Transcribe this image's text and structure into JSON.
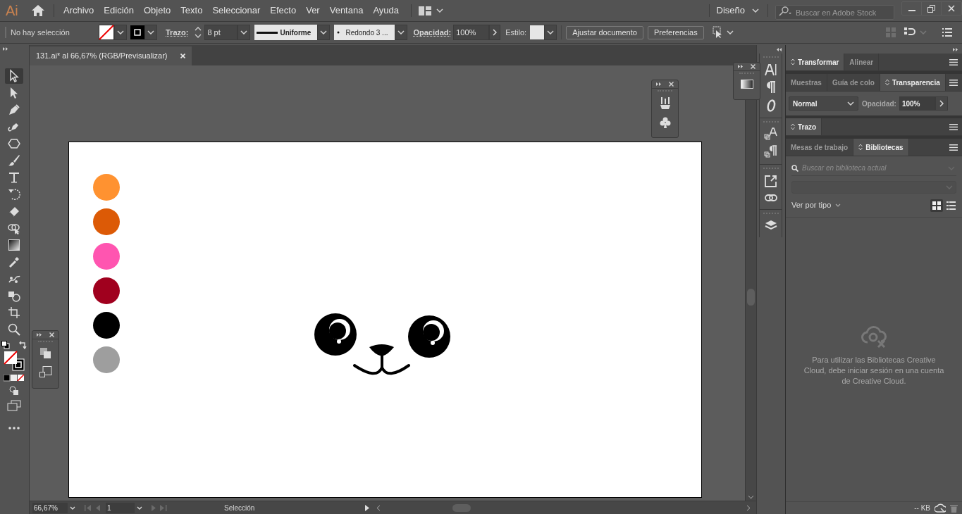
{
  "app_logo": "Ai",
  "menu": [
    "Archivo",
    "Edición",
    "Objeto",
    "Texto",
    "Seleccionar",
    "Efecto",
    "Ver",
    "Ventana",
    "Ayuda"
  ],
  "workspace": "Diseño",
  "stock_search": {
    "placeholder": "Buscar en Adobe Stock"
  },
  "control_bar": {
    "selection": "No hay selección",
    "stroke_label": "Trazo:",
    "stroke_weight": "8 pt",
    "stroke_profile": "Uniforme",
    "brush": "Redondo 3 ...",
    "opacity_label": "Opacidad:",
    "opacity": "100%",
    "style_label": "Estilo:",
    "buttons": [
      "Ajustar documento",
      "Preferencias"
    ]
  },
  "document_tab": {
    "title": "131.ai* al 66,67% (RGB/Previsualizar)"
  },
  "tools": [
    {
      "kind": "selection",
      "selected": true
    },
    {
      "kind": "direct-selection",
      "selected": false
    },
    {
      "kind": "pen",
      "selected": false
    },
    {
      "kind": "curvature",
      "selected": false
    },
    {
      "kind": "polygon",
      "selected": false
    },
    {
      "kind": "brush",
      "selected": false
    },
    {
      "kind": "type",
      "selected": false
    },
    {
      "kind": "rotate",
      "selected": false
    },
    {
      "kind": "eraser",
      "selected": false
    },
    {
      "kind": "shape-builder",
      "selected": false
    },
    {
      "kind": "gradient",
      "selected": false
    },
    {
      "kind": "eyedropper",
      "selected": false
    },
    {
      "kind": "puppet-warp",
      "selected": false
    },
    {
      "kind": "blend",
      "selected": false
    },
    {
      "kind": "artboard",
      "selected": false
    },
    {
      "kind": "zoom",
      "selected": false
    }
  ],
  "swatches": [
    {
      "color": "#ff9230"
    },
    {
      "color": "#dc5a06"
    },
    {
      "color": "#ff55b0"
    },
    {
      "color": "#a0001e"
    },
    {
      "color": "#000000"
    },
    {
      "color": "#9e9e9e"
    }
  ],
  "panels": [
    {
      "tabs": [
        {
          "label": "Transformar",
          "selected": true
        },
        {
          "label": "Alinear",
          "selected": false
        }
      ]
    },
    {
      "tabs": [
        {
          "label": "Muestras",
          "selected": false
        },
        {
          "label": "Guía de colo",
          "selected": false
        },
        {
          "label": "Transparencia",
          "selected": true
        }
      ]
    },
    {
      "tabs": [
        {
          "label": "Trazo",
          "selected": true
        }
      ]
    },
    {
      "tabs": [
        {
          "label": "Mesas de trabajo",
          "selected": false
        },
        {
          "label": "Bibliotecas",
          "selected": true
        }
      ]
    }
  ],
  "transparency": {
    "mode": "Normal",
    "opacity_label": "Opacidad:",
    "opacity": "100%"
  },
  "libraries": {
    "search_placeholder": "Buscar en biblioteca actual",
    "view_by": "Ver por tipo",
    "message": "Para utilizar las Bibliotecas Creative Cloud, debe iniciar sesión en una cuenta de Creative Cloud.",
    "size": "-- KB"
  },
  "status_bar": {
    "zoom": "66,67%",
    "artboard": "1",
    "tool": "Selección"
  }
}
